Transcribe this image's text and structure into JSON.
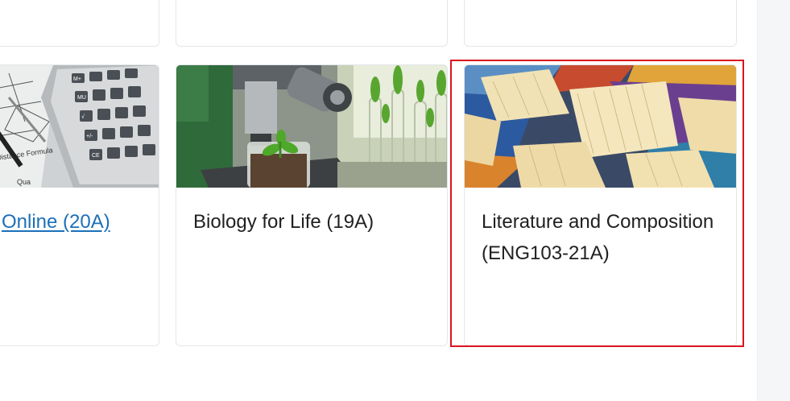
{
  "courses": [
    {
      "title": "Online (20A)",
      "image": "calculator-math-image",
      "is_link": true
    },
    {
      "title": "Biology for Life (19A)",
      "image": "microscope-plant-image",
      "is_link": false
    },
    {
      "title": "Literature and Composition (ENG103-21A)",
      "image": "books-image",
      "is_link": false,
      "highlighted": true
    }
  ],
  "colors": {
    "link": "#1c6fb8",
    "highlight": "#d8151f",
    "card_border": "#e3e6ea",
    "rail": "#f5f6f8"
  }
}
